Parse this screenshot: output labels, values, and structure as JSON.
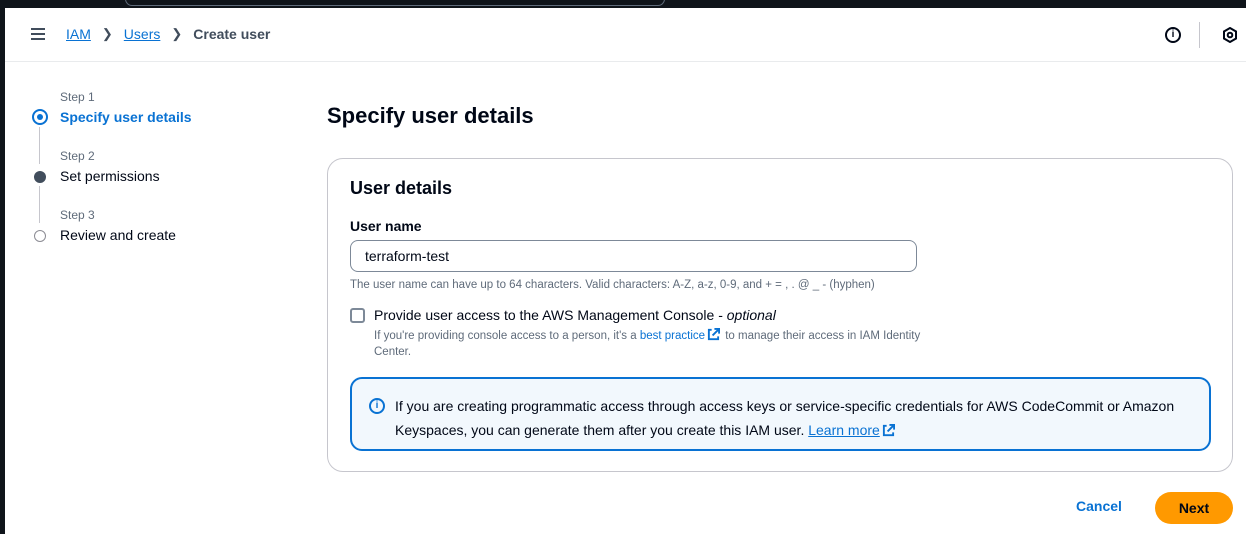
{
  "breadcrumbs": [
    "IAM",
    "Users",
    "Create user"
  ],
  "nav": {
    "info_label": "i"
  },
  "wizard": {
    "steps": [
      {
        "number": "Step 1",
        "title": "Specify user details",
        "state": "active"
      },
      {
        "number": "Step 2",
        "title": "Set permissions",
        "state": "filled"
      },
      {
        "number": "Step 3",
        "title": "Review and create",
        "state": "pending"
      }
    ]
  },
  "page": {
    "title": "Specify user details"
  },
  "user_details": {
    "header": "User details",
    "username_label": "User name",
    "username_value": "terraform-test",
    "username_hint": "The user name can have up to 64 characters. Valid characters: A-Z, a-z, 0-9, and + = , . @ _ - (hyphen)",
    "console_access_label": "Provide user access to the AWS Management Console - ",
    "console_access_optional": "optional",
    "console_access_checked": false,
    "console_desc_before": "If you're providing console access to a person, it's a ",
    "console_desc_link": "best practice",
    "console_desc_after": " to manage their access in IAM Identity Center."
  },
  "alert": {
    "icon_label": "i",
    "text": "If you are creating programmatic access through access keys or service-specific credentials for AWS CodeCommit or Amazon Keyspaces, you can generate them after you create this IAM user. ",
    "link": "Learn more"
  },
  "actions": {
    "cancel": "Cancel",
    "next": "Next"
  },
  "colors": {
    "accent": "#0972d3",
    "primary_button": "#ff9900",
    "text": "#000716",
    "muted": "#5f6b7a"
  }
}
